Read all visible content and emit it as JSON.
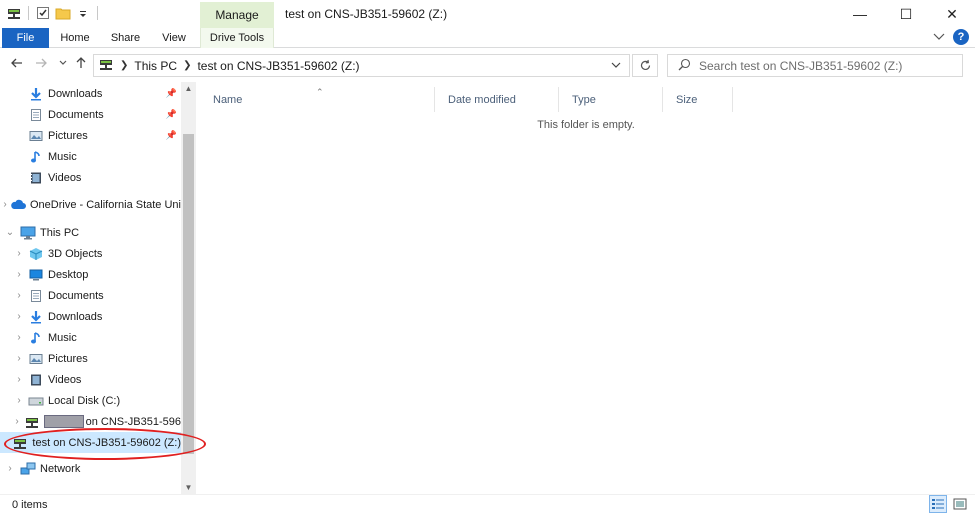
{
  "window": {
    "title": "test on CNS-JB351-59602 (Z:)",
    "contextual_tab": "Manage",
    "minimize_glyph": "—",
    "maximize_glyph": "☐",
    "close_glyph": "✕"
  },
  "ribbon": {
    "tabs": [
      {
        "label": "File"
      },
      {
        "label": "Home"
      },
      {
        "label": "Share"
      },
      {
        "label": "View"
      },
      {
        "label": "Drive Tools"
      }
    ],
    "help_label": "?"
  },
  "address": {
    "crumbs": [
      "This PC",
      "test on CNS-JB351-59602 (Z:)"
    ],
    "search_placeholder": "Search test on CNS-JB351-59602 (Z:)"
  },
  "nav_pane": {
    "items": [
      {
        "label": "Downloads",
        "icon": "download-arrow-icon",
        "pinned": true
      },
      {
        "label": "Documents",
        "icon": "document-icon",
        "pinned": true
      },
      {
        "label": "Pictures",
        "icon": "pictures-icon",
        "pinned": true
      },
      {
        "label": "Music",
        "icon": "music-note-icon",
        "pinned": false
      },
      {
        "label": "Videos",
        "icon": "video-icon",
        "pinned": false
      },
      {
        "label": "OneDrive - California State Uni",
        "icon": "cloud-icon"
      },
      {
        "label": "This PC",
        "icon": "computer-icon"
      },
      {
        "label": "3D Objects",
        "icon": "cube-icon"
      },
      {
        "label": "Desktop",
        "icon": "desktop-icon"
      },
      {
        "label": "Documents",
        "icon": "document-icon"
      },
      {
        "label": "Downloads",
        "icon": "download-arrow-icon"
      },
      {
        "label": "Music",
        "icon": "music-note-icon"
      },
      {
        "label": "Pictures",
        "icon": "pictures-icon"
      },
      {
        "label": "Videos",
        "icon": "video-icon"
      },
      {
        "label": "Local Disk (C:)",
        "icon": "local-disk-icon"
      },
      {
        "label": "on CNS-JB351-596",
        "icon": "network-drive-icon"
      },
      {
        "label": "test on CNS-JB351-59602 (Z:)",
        "icon": "network-drive-icon"
      },
      {
        "label": "Network",
        "icon": "network-icon"
      }
    ]
  },
  "content": {
    "columns": [
      {
        "label": "Name"
      },
      {
        "label": "Date modified"
      },
      {
        "label": "Type"
      },
      {
        "label": "Size"
      }
    ],
    "empty_message": "This folder is empty."
  },
  "status": {
    "item_count": "0 items"
  },
  "colors": {
    "accent": "#1a64c2",
    "manage_tab": "#e2f0d4",
    "selection": "#cce8ff",
    "annotation": "#e02020"
  }
}
